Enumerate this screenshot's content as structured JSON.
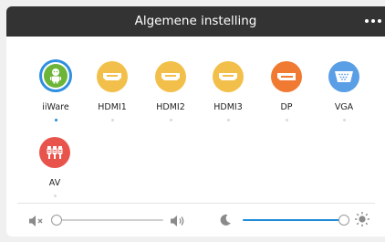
{
  "window": {
    "title": "Algemene instelling",
    "menu_icon": "more-horizontal-icon"
  },
  "sources": [
    {
      "label": "iiWare",
      "icon": "android-robot-icon",
      "color": "#6cb538",
      "selected": true
    },
    {
      "label": "HDMI1",
      "icon": "hdmi-port-icon",
      "color": "#f2c04a",
      "selected": false
    },
    {
      "label": "HDMI2",
      "icon": "hdmi-port-icon",
      "color": "#f2c04a",
      "selected": false
    },
    {
      "label": "HDMI3",
      "icon": "hdmi-port-icon",
      "color": "#f2c04a",
      "selected": false
    },
    {
      "label": "DP",
      "icon": "displayport-icon",
      "color": "#f07a32",
      "selected": false
    },
    {
      "label": "VGA",
      "icon": "vga-port-icon",
      "color": "#5a9ee6",
      "selected": false
    },
    {
      "label": "AV",
      "icon": "rca-av-icon",
      "color": "#e8544c",
      "selected": false
    }
  ],
  "volume": {
    "min_icon": "speaker-mute-icon",
    "max_icon": "speaker-loud-icon",
    "level": 0
  },
  "brightness": {
    "min_icon": "moon-icon",
    "max_icon": "sun-icon",
    "level": 1.0
  },
  "colors": {
    "titlebar": "#333333",
    "accent": "#1e8bd9",
    "selection_ring": "#2f8fe0"
  }
}
